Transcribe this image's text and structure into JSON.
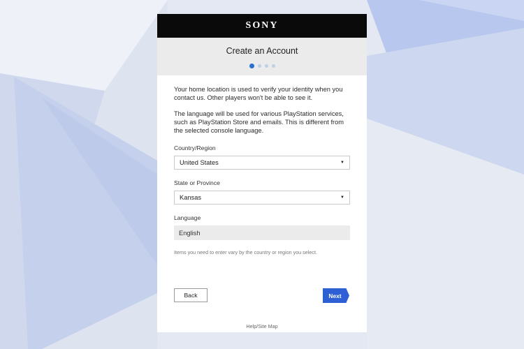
{
  "brand": {
    "logo_text": "SONY"
  },
  "header": {
    "title": "Create an Account",
    "step_count": 4,
    "current_step": 1
  },
  "intro": {
    "para1": "Your home location is used to verify your identity when you contact us. Other players won't be able to see it.",
    "para2": "The language will be used for various PlayStation services, such as PlayStation Store and emails. This is different from the selected console language."
  },
  "form": {
    "country": {
      "label": "Country/Region",
      "value": "United States"
    },
    "state": {
      "label": "State or Province",
      "value": "Kansas"
    },
    "language": {
      "label": "Language",
      "value": "English"
    },
    "hint": "Items you need to enter vary by the country or region you select."
  },
  "buttons": {
    "back": "Back",
    "next": "Next"
  },
  "footer": {
    "link": "Help/Site Map"
  },
  "colors": {
    "accent": "#2e5fd4",
    "active_step": "#2a6fd0",
    "inactive_step": "#bcd0e6",
    "brand_bar": "#0a0a0a"
  }
}
